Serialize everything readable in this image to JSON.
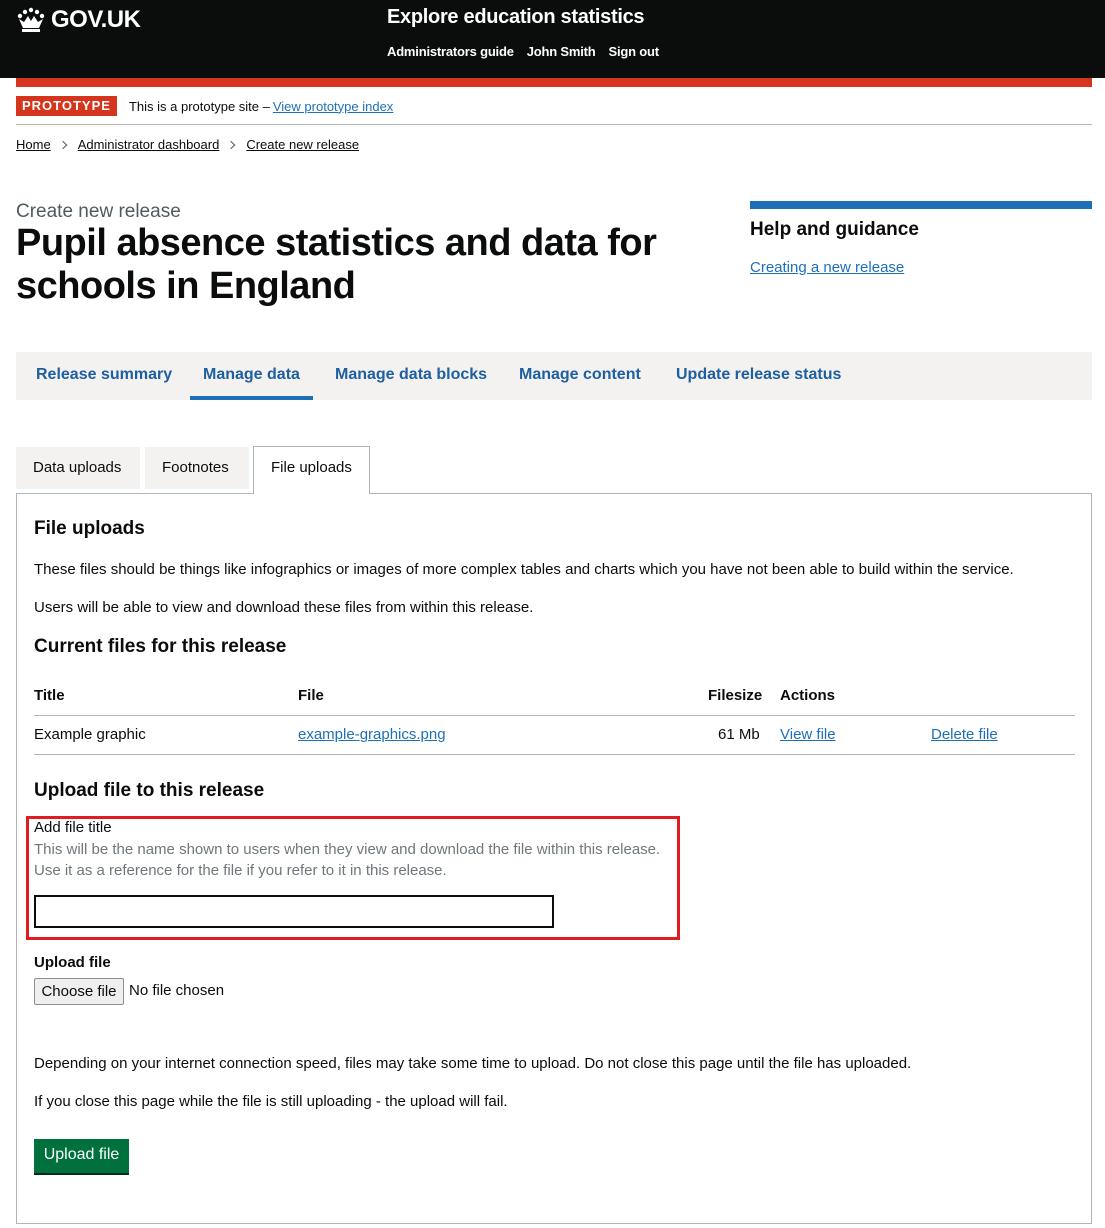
{
  "header": {
    "logo_text": "GOV.UK",
    "service_name": "Explore education statistics",
    "nav": [
      "Administrators guide",
      "John Smith",
      "Sign out"
    ]
  },
  "prototype_banner": {
    "tag": "PROTOTYPE",
    "text": "This is a prototype site –",
    "link": "View prototype index"
  },
  "breadcrumbs": [
    "Home",
    "Administrator dashboard",
    "Create new release"
  ],
  "page": {
    "caption": "Create new release",
    "title": "Pupil absence statistics and data for schools in England"
  },
  "help": {
    "title": "Help and guidance",
    "link": "Creating a new release"
  },
  "main_nav": {
    "items": [
      "Release summary",
      "Manage data",
      "Manage data blocks",
      "Manage content",
      "Update release status"
    ],
    "active": "Manage data"
  },
  "tabs": {
    "items": [
      "Data uploads",
      "Footnotes",
      "File uploads"
    ],
    "selected": "File uploads"
  },
  "file_uploads": {
    "heading": "File uploads",
    "intro": [
      "These files should be things like infographics or images of more complex tables and charts which you have not been able to build within the service.",
      "Users will be able to view and download these files from within this release."
    ],
    "current_heading": "Current files for this release",
    "table": {
      "headers": [
        "Title",
        "File",
        "Filesize",
        "Actions"
      ],
      "rows": [
        {
          "title": "Example graphic",
          "file": "example-graphics.png",
          "filesize": "61 Mb",
          "view": "View file",
          "delete": "Delete file"
        }
      ]
    },
    "upload_heading": "Upload file to this release",
    "title_field": {
      "label": "Add file title",
      "hint_lines": [
        "This will be the name shown to users when they view and download the file within this release.",
        "Use it as a reference for the file if you refer to it in this release."
      ],
      "value": ""
    },
    "file_field": {
      "label": "Upload file",
      "button": "Choose file",
      "status": "No file chosen"
    },
    "notes": [
      "Depending on your internet connection speed, files may take some time to upload. Do not close this page until the file has uploaded.",
      "If you close this page while the file is still uploading - the upload will fail."
    ],
    "submit": "Upload file"
  },
  "colors": {
    "header_bg": "#0b0c0c",
    "brand_red": "#d4351c",
    "link_blue": "#1d70b8",
    "button_green": "#00703c",
    "highlight_red": "#e11b22"
  }
}
